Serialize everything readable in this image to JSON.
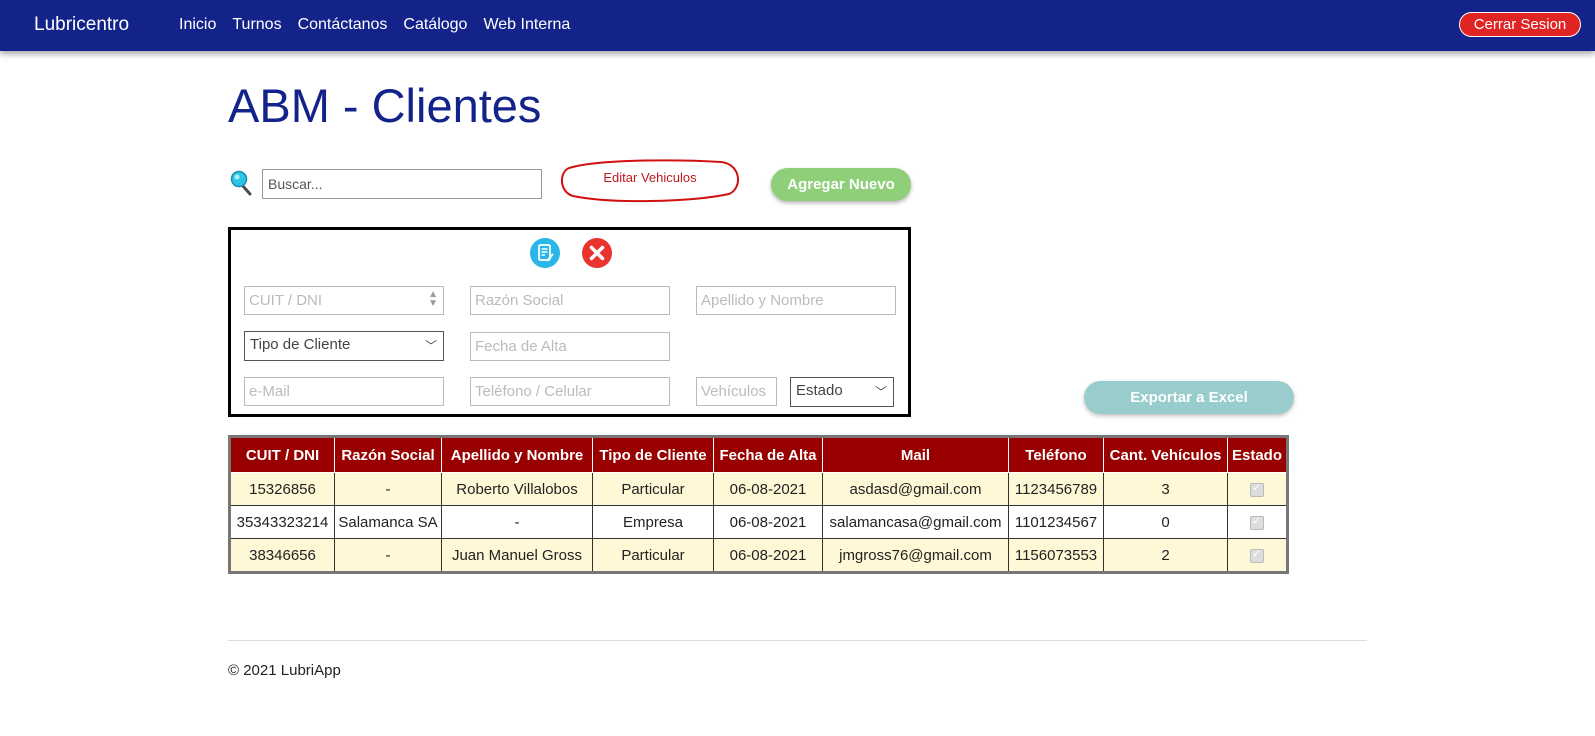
{
  "navbar": {
    "brand": "Lubricentro",
    "links": [
      "Inicio",
      "Turnos",
      "Contáctanos",
      "Catálogo",
      "Web Interna"
    ],
    "logout_label": "Cerrar Sesion"
  },
  "page_title": "ABM - Clientes",
  "search": {
    "placeholder": "Buscar..."
  },
  "edit_vehicles_label": "Editar Vehiculos",
  "add_new_label": "Agregar Nuevo",
  "form": {
    "cuit_placeholder": "CUIT / DNI",
    "razon_social_placeholder": "Razón Social",
    "apellido_nombre_placeholder": "Apellido y Nombre",
    "tipo_cliente_selected": "Tipo de Cliente",
    "fecha_alta_placeholder": "Fecha de Alta",
    "email_placeholder": "e-Mail",
    "telefono_placeholder": "Teléfono / Celular",
    "vehiculos_placeholder": "Vehículos",
    "estado_selected": "Estado"
  },
  "export_label": "Exportar a Excel",
  "table": {
    "headers": [
      "CUIT / DNI",
      "Razón Social",
      "Apellido y Nombre",
      "Tipo de Cliente",
      "Fecha de Alta",
      "Mail",
      "Teléfono",
      "Cant. Vehículos",
      "Estado"
    ],
    "rows": [
      [
        "15326856",
        "-",
        "Roberto Villalobos",
        "Particular",
        "06-08-2021",
        "asdasd@gmail.com",
        "1123456789",
        "3"
      ],
      [
        "35343323214",
        "Salamanca SA",
        "-",
        "Empresa",
        "06-08-2021",
        "salamancasa@gmail.com",
        "1101234567",
        "0"
      ],
      [
        "38346656",
        "-",
        "Juan Manuel Gross",
        "Particular",
        "06-08-2021",
        "jmgross76@gmail.com",
        "1156073553",
        "2"
      ]
    ],
    "estado_checked": [
      true,
      true,
      true
    ]
  },
  "footer": "© 2021 LubriApp",
  "colors": {
    "navbar": "#14238a",
    "logout": "#e02424",
    "add_button": "#8fcf79",
    "export_button": "#99cccc",
    "table_header": "#990000",
    "row_highlight": "#fff8d6",
    "title": "#14238a"
  }
}
